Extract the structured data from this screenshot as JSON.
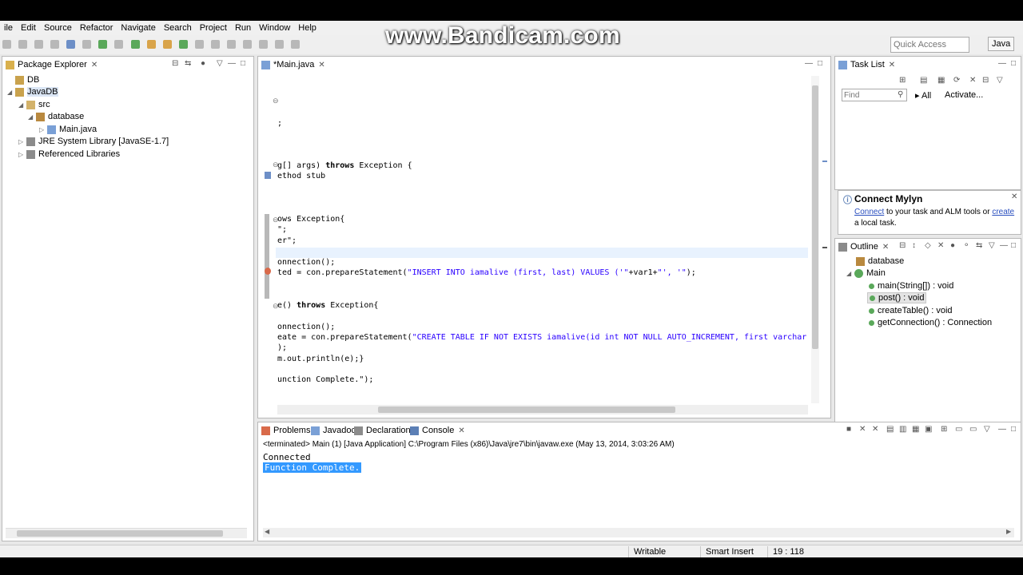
{
  "watermark": "www.Bandicam.com",
  "menu": [
    "File",
    "Edit",
    "Source",
    "Refactor",
    "Navigate",
    "Search",
    "Project",
    "Run",
    "Window",
    "Help"
  ],
  "menu_first_visible": "ile",
  "quick_access": {
    "placeholder": "Quick Access"
  },
  "perspective": "Java",
  "package_explorer": {
    "title": "Package Explorer",
    "items": [
      {
        "label": "DB"
      },
      {
        "label": "JavaDB"
      },
      {
        "label": "src"
      },
      {
        "label": "database"
      },
      {
        "label": "Main.java"
      },
      {
        "label": "JRE System Library [JavaSE-1.7]"
      },
      {
        "label": "Referenced Libraries"
      }
    ]
  },
  "editor": {
    "tab": "*Main.java",
    "lines": [
      {
        "text": ";"
      },
      {
        "text": "g[] args) ",
        "kw": "throws",
        "rest": " Exception {"
      },
      {
        "text": "ethod stub"
      },
      {
        "text": "ows Exception{"
      },
      {
        "text": "\";"
      },
      {
        "text": "er\";"
      },
      {
        "text": "onnection();"
      },
      {
        "text": "ted = con.prepareStatement(",
        "str": "\"INSERT INTO iamalive (first, last) VALUES ('\"",
        "rest": "+var1+",
        "str2": "\"', '\"",
        "rest2": ");"
      },
      {
        "text": "e() ",
        "kw": "throws",
        "rest": " Exception{"
      },
      {
        "text": "onnection();"
      },
      {
        "text": "eate = con.prepareStatement(",
        "str": "\"CREATE TABLE IF NOT EXISTS iamalive(id int NOT NULL AUTO_INCREMENT, first varchar"
      },
      {
        "text": ");"
      },
      {
        "text": "m.out.println(e);}"
      },
      {
        "text": "unction Complete.\");"
      }
    ]
  },
  "task_list": {
    "title": "Task List",
    "find_placeholder": "Find",
    "all": "All",
    "activate": "Activate..."
  },
  "mylyn": {
    "title": "Connect Mylyn",
    "connect": "Connect",
    "text1": " to your task and ALM tools or ",
    "create": "create",
    "text2": "a local task."
  },
  "outline": {
    "title": "Outline",
    "items": [
      {
        "label": "database"
      },
      {
        "label": "Main"
      },
      {
        "label": "main(String[]) : void"
      },
      {
        "label": "post() : void"
      },
      {
        "label": "createTable() : void"
      },
      {
        "label": "getConnection() : Connection"
      }
    ]
  },
  "bottom_tabs": [
    "Problems",
    "Javadoc",
    "Declaration",
    "Console"
  ],
  "console": {
    "header": "<terminated> Main (1) [Java Application] C:\\Program Files (x86)\\Java\\jre7\\bin\\javaw.exe (May 13, 2014, 3:03:26 AM)",
    "lines": [
      "Connected",
      "Function Complete."
    ]
  },
  "status": {
    "writable": "Writable",
    "insert": "Smart Insert",
    "position": "19 : 118"
  },
  "colors": {
    "selection": "#3399ff",
    "string": "#2a00ff",
    "bg": "#e8e8e8"
  }
}
